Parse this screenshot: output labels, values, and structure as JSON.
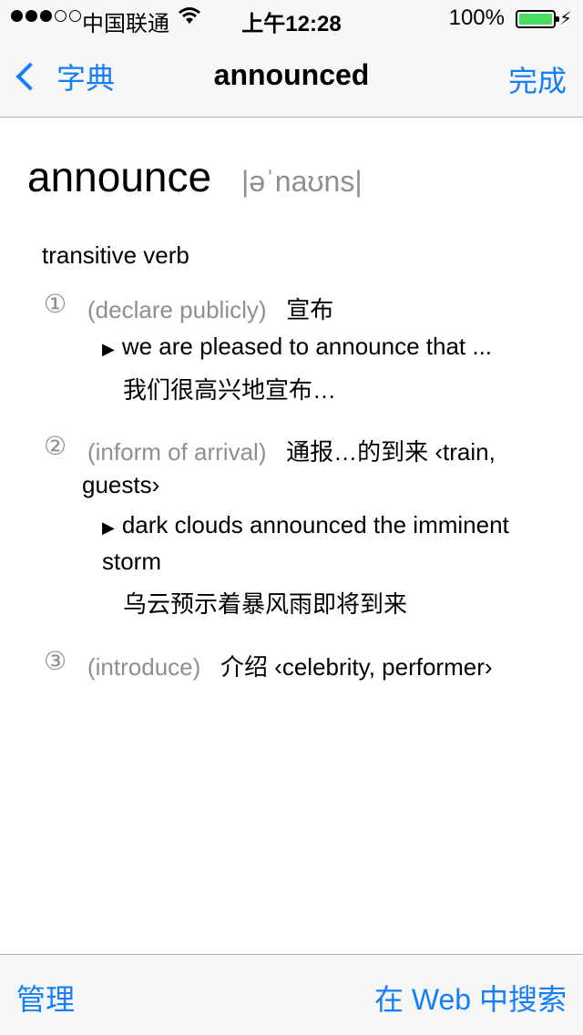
{
  "status_bar": {
    "carrier": "中国联通",
    "time": "上午12:28",
    "battery": "100%",
    "signal_bars_filled": 3,
    "signal_bars_total": 5,
    "battery_level": 1.0
  },
  "nav": {
    "back_label": "字典",
    "title": "announced",
    "done_label": "完成"
  },
  "entry": {
    "headword": "announce",
    "pronunciation": "|əˈnaʊns|",
    "part_of_speech": "transitive verb",
    "senses": [
      {
        "number": "①",
        "gloss": "(declare publicly)",
        "translation": "宣布",
        "example_en": "we are pleased to announce that ...",
        "example_zh": "我们很高兴地宣布…"
      },
      {
        "number": "②",
        "gloss": "(inform of arrival)",
        "translation": "通报…的到来 ‹train,",
        "translation_cont": "guests›",
        "example_en": "dark clouds announced the imminent",
        "example_en_cont": "storm",
        "example_zh": "乌云预示着暴风雨即将到来"
      },
      {
        "number": "③",
        "gloss": "(introduce)",
        "translation": "介绍 ‹celebrity, performer›"
      }
    ]
  },
  "toolbar": {
    "manage_label": "管理",
    "web_search_label": "在 Web 中搜索"
  },
  "colors": {
    "accent": "#147efb",
    "muted": "#8e8e93",
    "battery_green": "#4cd964",
    "bar_bg": "#f7f7f7"
  }
}
